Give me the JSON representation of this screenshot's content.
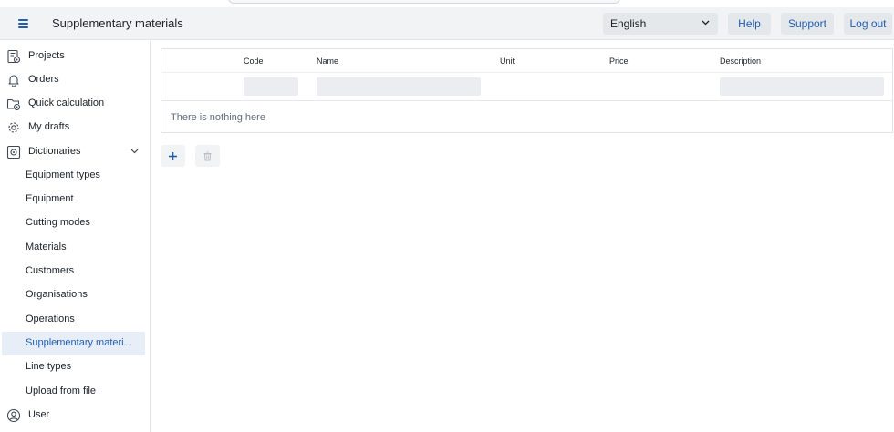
{
  "header": {
    "title": "Supplementary materials",
    "language": "English",
    "help_label": "Help",
    "support_label": "Support",
    "logout_label": "Log out"
  },
  "sidebar": {
    "items": [
      {
        "label": "Projects",
        "icon": "projects-icon"
      },
      {
        "label": "Orders",
        "icon": "bell-icon"
      },
      {
        "label": "Quick calculation",
        "icon": "folder-gear-icon"
      },
      {
        "label": "My drafts",
        "icon": "gear-icon"
      },
      {
        "label": "Dictionaries",
        "icon": "dictionaries-icon"
      },
      {
        "label": "Equipment types"
      },
      {
        "label": "Equipment"
      },
      {
        "label": "Cutting modes"
      },
      {
        "label": "Materials"
      },
      {
        "label": "Customers"
      },
      {
        "label": "Organisations"
      },
      {
        "label": "Operations"
      },
      {
        "label": "Supplementary materi..."
      },
      {
        "label": "Line types"
      },
      {
        "label": "Upload from file"
      },
      {
        "label": "User",
        "icon": "user-icon"
      }
    ]
  },
  "table": {
    "columns": [
      "Code",
      "Name",
      "Unit",
      "Price",
      "Description"
    ],
    "empty_text": "There is nothing here"
  },
  "actions": {
    "add_icon": "plus-icon",
    "delete_icon": "trash-icon"
  },
  "colors": {
    "accent": "#215db0",
    "header_bg": "#f2f3f5",
    "active_bg": "#e7eef8"
  }
}
